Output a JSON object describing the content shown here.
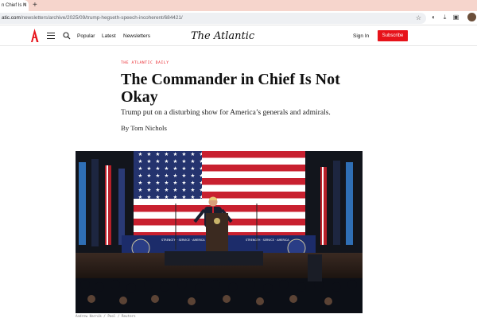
{
  "browser": {
    "tab_title": "n Chief Is N",
    "tab_close": "×",
    "new_tab": "+",
    "url_host": "atic.com",
    "url_path": "/newsletters/archive/2025/09/trump-hegseth-speech-incoherent/684421/",
    "star": "☆"
  },
  "header": {
    "nav": [
      "Popular",
      "Latest",
      "Newsletters"
    ],
    "brand": "The Atlantic",
    "sign_in": "Sign In",
    "subscribe": "Subscribe",
    "accent_color": "#e7131a"
  },
  "article": {
    "kicker": "THE ATLANTIC DAILY",
    "headline": "The Commander in Chief Is Not Okay",
    "dek": "Trump put on a disturbing show for America’s generals and admirals.",
    "byline": "By Tom Nichols",
    "stage_banner_left": "STRENGTH · SERVICE · AMERICA",
    "stage_banner_right": "STRENGTH · SERVICE · AMERICA",
    "photo_credit": "Andrew Harnik / Pool / Reuters"
  },
  "icons": {
    "logo": "atlantic-a-logo",
    "menu": "hamburger-menu-icon",
    "search": "search-icon",
    "star": "bookmark-star-icon"
  }
}
